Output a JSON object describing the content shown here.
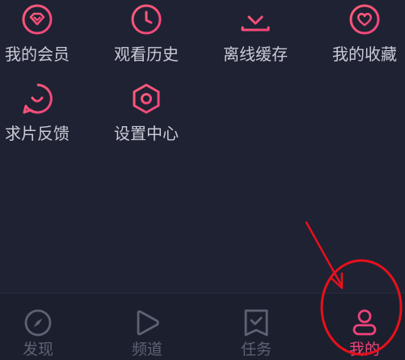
{
  "menu": {
    "items": [
      {
        "label": "我的会员",
        "icon": "diamond-icon"
      },
      {
        "label": "观看历史",
        "icon": "clock-icon"
      },
      {
        "label": "离线缓存",
        "icon": "download-icon"
      },
      {
        "label": "我的收藏",
        "icon": "heart-icon"
      },
      {
        "label": "求片反馈",
        "icon": "feedback-icon"
      },
      {
        "label": "设置中心",
        "icon": "settings-hex-icon"
      }
    ]
  },
  "tabbar": {
    "tabs": [
      {
        "label": "发现",
        "icon": "compass-icon",
        "active": false
      },
      {
        "label": "频道",
        "icon": "play-icon",
        "active": false
      },
      {
        "label": "任务",
        "icon": "task-icon",
        "active": false
      },
      {
        "label": "我的",
        "icon": "user-icon",
        "active": true
      }
    ]
  },
  "colors": {
    "background": "#1f2233",
    "accent": "#f0437a",
    "text": "#c9cbd6",
    "inactive": "#5d6275",
    "annotation": "#e8101c"
  }
}
